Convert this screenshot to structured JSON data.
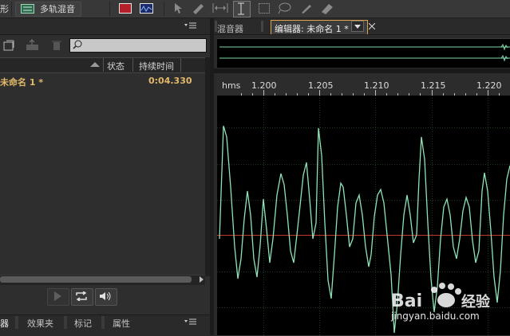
{
  "toolbar": {
    "waveform_label_partial": "形",
    "multitrack_label": "多轨混音"
  },
  "files_panel": {
    "columns": [
      "状态",
      "持续时间"
    ],
    "rows": [
      {
        "name": "未命名 1 *",
        "duration": "0:04.330"
      }
    ]
  },
  "bottom_tabs": [
    "器",
    "效果夹",
    "标记",
    "属性"
  ],
  "right_tabs": {
    "mixer": "混音器",
    "editor": "编辑器: 未命名 1 *"
  },
  "ruler": {
    "unit": "hms",
    "ticks": [
      "1.200",
      "1.205",
      "1.210",
      "1.215",
      "1.220"
    ]
  },
  "colors": {
    "waveform": "#8fe3b8",
    "centerline": "#c0392b",
    "accent_tab": "#e0a24c",
    "file_name": "#e3b86a"
  },
  "watermark": {
    "brand": "Bai du 经验",
    "url": "jingyan.baidu.com"
  }
}
